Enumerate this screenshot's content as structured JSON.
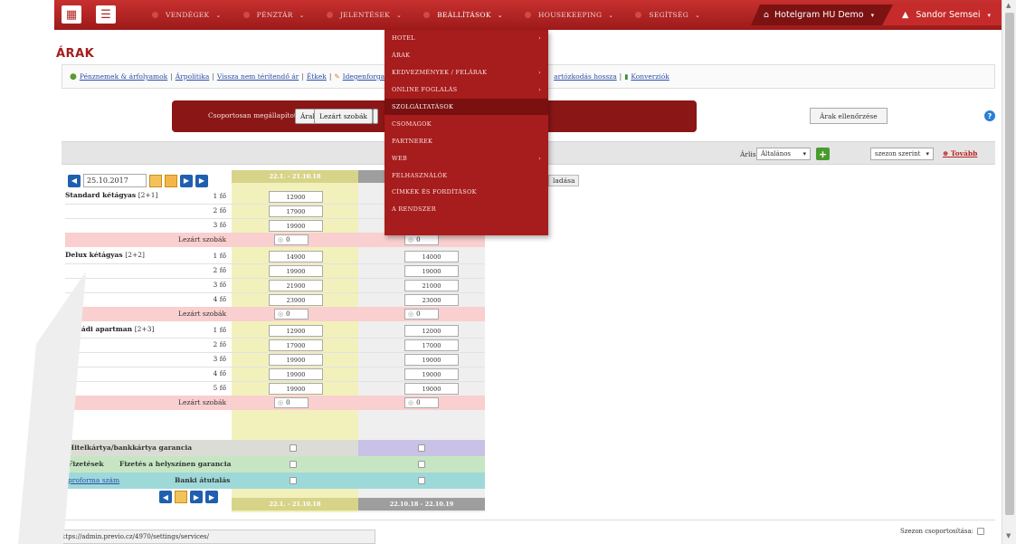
{
  "topbar": {
    "menu": [
      {
        "label": "VENDÉGEK",
        "active": false
      },
      {
        "label": "PÉNZTÁR",
        "active": false
      },
      {
        "label": "JELENTÉSEK",
        "active": false
      },
      {
        "label": "BEÁLLÍTÁSOK",
        "active": true
      },
      {
        "label": "HOUSEKEEPING",
        "active": false
      },
      {
        "label": "SEGÍTSÉG",
        "active": false
      }
    ],
    "hotel": "Hotelgram HU Demo",
    "user": "Sandor Semsei"
  },
  "page_title": "ÁRAK",
  "links": {
    "money": "Pénznemek & árfolyamok",
    "pricing_policy": "Árpolitika",
    "refund": "Vissza nem térítendő ár",
    "meals": "Étkek",
    "tourist_tax": "Idegenforga",
    "stay_length": "artózkodás hossza",
    "conversions": "Konverziók"
  },
  "group_bar": {
    "label": "Csoportosan megállapított:",
    "prices_btn": "Árak",
    "locked_btn": "Lezárt szobák",
    "check_btn": "Árak ellenőrzése"
  },
  "filter": {
    "price_list_label": "Árlista:",
    "price_list_value": "Általános",
    "season_value": "szezon szerint",
    "more_link": "Tovább"
  },
  "grid": {
    "date": "25.10.2017",
    "col1_header": "22.1. - 21.10.18",
    "col2_header": "22.10.18 - 22.10.19",
    "add_partial": "ladása",
    "locked_label": "Lezárt szobák",
    "person_unit": "fő",
    "rooms": [
      {
        "name": "Standard kétágyas",
        "cap": "[2+1]",
        "rows": [
          {
            "p": "1 fő",
            "c1": "12900",
            "c2": ""
          },
          {
            "p": "2 fő",
            "c1": "17900",
            "c2": ""
          },
          {
            "p": "3 fő",
            "c1": "19900",
            "c2": ""
          }
        ],
        "locked": [
          "0",
          "0"
        ]
      },
      {
        "name": "Delux kétágyas",
        "cap": "[2+2]",
        "rows": [
          {
            "p": "1 fő",
            "c1": "14900",
            "c2": "14000"
          },
          {
            "p": "2 fő",
            "c1": "19900",
            "c2": "19000"
          },
          {
            "p": "3 fő",
            "c1": "21900",
            "c2": "21000"
          },
          {
            "p": "4 fő",
            "c1": "23900",
            "c2": "23000"
          }
        ],
        "locked": [
          "0",
          "0"
        ]
      },
      {
        "name": "Családi apartman",
        "cap": "[2+3]",
        "rows": [
          {
            "p": "1 fő",
            "c1": "12900",
            "c2": "12000"
          },
          {
            "p": "2 fő",
            "c1": "17900",
            "c2": "17000"
          },
          {
            "p": "3 fő",
            "c1": "19900",
            "c2": "19000"
          },
          {
            "p": "4 fő",
            "c1": "19900",
            "c2": "19000"
          },
          {
            "p": "5 fő",
            "c1": "19900",
            "c2": "19000"
          }
        ],
        "locked": [
          "0",
          "0"
        ]
      }
    ],
    "credit_card": "Hitelkártya/bankkártya garancia",
    "payments": "Fizetések",
    "onsite": "Fizetés a helyszínen garancia",
    "proforma": "proforma szám",
    "bank": "Banki átutalás"
  },
  "dropdown": [
    {
      "label": "HOTEL",
      "sub": true,
      "hl": false
    },
    {
      "label": "ÁRAK",
      "sub": false,
      "hl": false
    },
    {
      "label": "KEDVEZMÉNYEK / FELÁRAK",
      "sub": true,
      "hl": false
    },
    {
      "label": "ONLINE FOGLALÁS",
      "sub": true,
      "hl": false
    },
    {
      "label": "SZOLGÁLTATÁSOK",
      "sub": false,
      "hl": true
    },
    {
      "label": "CSOMAGOK",
      "sub": false,
      "hl": false
    },
    {
      "label": "PARTNEREK",
      "sub": false,
      "hl": false
    },
    {
      "label": "WEB",
      "sub": true,
      "hl": false
    },
    {
      "label": "FELHASZNÁLÓK",
      "sub": false,
      "hl": false
    },
    {
      "label": "CÍMKÉK ÉS FORDÍTÁSOK",
      "sub": false,
      "hl": false
    },
    {
      "label": "A RENDSZER",
      "sub": false,
      "hl": false
    }
  ],
  "status_url": "https://admin.previo.cz/4970/settings/services/",
  "season_group_label": "Szezon csoportosítása:",
  "colors": {
    "brand_red": "#a71c1c",
    "dark_red": "#7a1010",
    "yellow_col": "#f2f1bc",
    "locked_pink": "#f9cfcf",
    "lilac": "#c9c2e6",
    "green": "#c6e6c3",
    "teal": "#9ed9da"
  }
}
